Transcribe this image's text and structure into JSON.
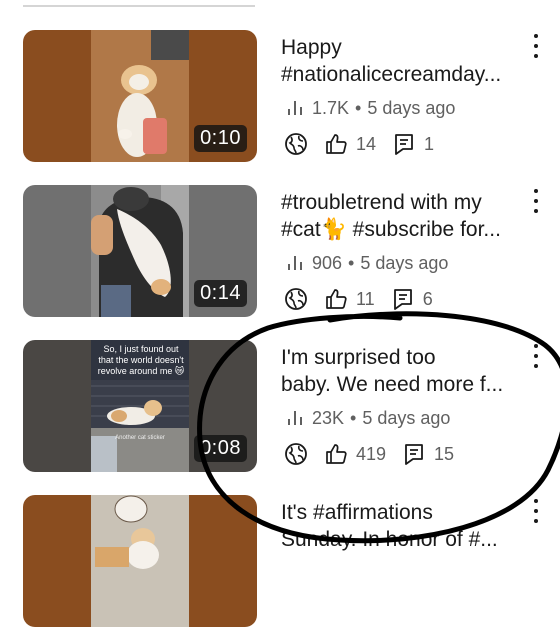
{
  "videos": [
    {
      "title_lines": [
        "Happy",
        "#nationalicecreamday..."
      ],
      "views": "1.7K",
      "age": "5 days ago",
      "likes": "14",
      "comments": "1",
      "duration": "0:10",
      "thumb_caption": [],
      "thumb_sticker": ""
    },
    {
      "title_lines": [
        "#troubletrend with my",
        "#cat🐈 #subscribe for..."
      ],
      "views": "906",
      "age": "5 days ago",
      "likes": "11",
      "comments": "6",
      "duration": "0:14",
      "thumb_caption": [],
      "thumb_sticker": ""
    },
    {
      "title_lines": [
        "I'm surprised too",
        "baby. We need more f..."
      ],
      "views": "23K",
      "age": "5 days ago",
      "likes": "419",
      "comments": "15",
      "duration": "0:08",
      "thumb_caption": [
        "So, I just found out",
        "that the world doesn't",
        "revolve around me 😿"
      ],
      "thumb_sticker": "Another cat sticker"
    },
    {
      "title_lines": [
        "It's #affirmations",
        "Sunday. In honor of #..."
      ],
      "views": "",
      "age": "",
      "likes": "",
      "comments": "",
      "duration": "",
      "thumb_caption": [],
      "thumb_sticker": ""
    }
  ],
  "separator": "•",
  "icons": {
    "views": "bar-chart-icon",
    "visibility": "globe-icon",
    "likes": "thumb-up-icon",
    "comments": "comment-icon",
    "menu": "more-vert-icon"
  },
  "colors": {
    "text": "#0f0f0f",
    "meta": "#606060",
    "duration_bg": "#141414",
    "annotation_ink": "#000000"
  }
}
